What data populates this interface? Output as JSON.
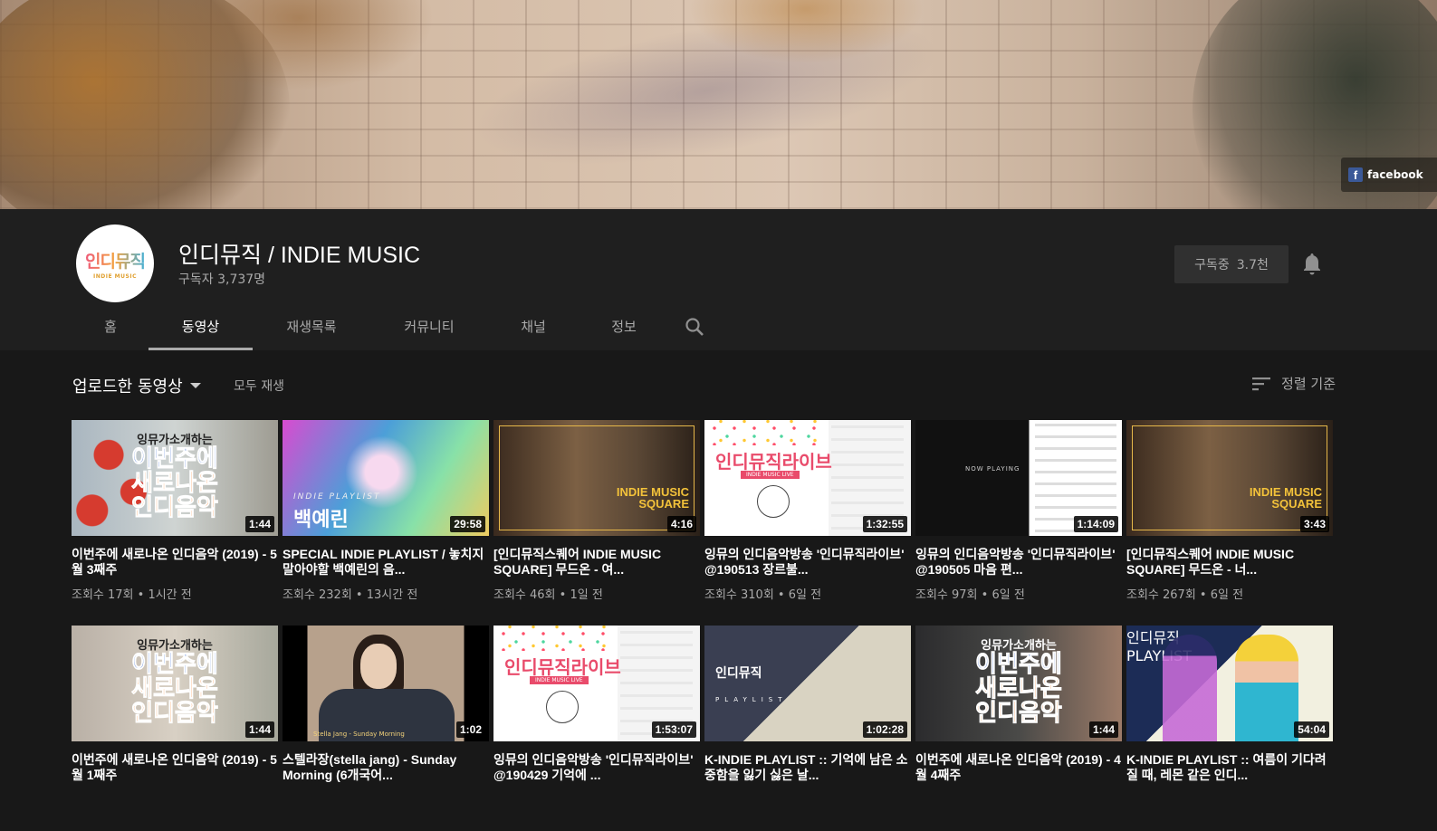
{
  "banner": {
    "facebook_label": "facebook"
  },
  "channel": {
    "avatar_text": "인디뮤직",
    "avatar_subtext": "INDIE MUSIC",
    "title": "인디뮤직 / INDIE MUSIC",
    "subscribers": "구독자 3,737명",
    "subscribe_label": "구독중",
    "subscribe_count": "3.7천"
  },
  "tabs": [
    {
      "label": "홈"
    },
    {
      "label": "동영상",
      "active": true
    },
    {
      "label": "재생목록"
    },
    {
      "label": "커뮤니티"
    },
    {
      "label": "채널"
    },
    {
      "label": "정보"
    }
  ],
  "section": {
    "uploads_label": "업로드한 동영상",
    "play_all": "모두 재생",
    "sort_label": "정렬 기준"
  },
  "thumb_text": {
    "curator": "잉뮤가소개하는",
    "line1": "이번주에",
    "line2": "새로나온",
    "line3": "인디음악",
    "indie_playlist": "INDIE PLAYLIST",
    "playlist_name": "백예린",
    "square_line1": "INDIE MUSIC",
    "square_line2": "SQUARE",
    "live_title": "인디뮤직라이브",
    "live_sub": "INDIE MUSIC LIVE",
    "now_playing": "NOW PLAYING",
    "girl_caption": "Stella Jang - Sunday Morning",
    "kp_title": "인디뮤직",
    "kp_sub": "PLAYLIST"
  },
  "videos": [
    {
      "title": "이번주에 새로나온 인디음악 (2019) - 5월 3째주",
      "views": "조회수 17회",
      "age": "1시간 전",
      "duration": "1:44"
    },
    {
      "title": "SPECIAL INDIE PLAYLIST / 놓치지 말아야할 백예린의 음...",
      "views": "조회수 232회",
      "age": "13시간 전",
      "duration": "29:58"
    },
    {
      "title": "[인디뮤직스퀘어 INDIE MUSIC SQUARE] 무드온 - 여...",
      "views": "조회수 46회",
      "age": "1일 전",
      "duration": "4:16"
    },
    {
      "title": "잉뮤의 인디음악방송 '인디뮤직라이브' @190513 장르불...",
      "views": "조회수 310회",
      "age": "6일 전",
      "duration": "1:32:55"
    },
    {
      "title": "잉뮤의 인디음악방송 '인디뮤직라이브' @190505 마음 편...",
      "views": "조회수 97회",
      "age": "6일 전",
      "duration": "1:14:09"
    },
    {
      "title": "[인디뮤직스퀘어 INDIE MUSIC SQUARE] 무드온 - 너...",
      "views": "조회수 267회",
      "age": "6일 전",
      "duration": "3:43"
    },
    {
      "title": "이번주에 새로나온 인디음악 (2019) - 5월 1째주",
      "views": "",
      "age": "",
      "duration": "1:44"
    },
    {
      "title": "스텔라장(stella jang) - Sunday Morning (6개국어...",
      "views": "",
      "age": "",
      "duration": "1:02"
    },
    {
      "title": "잉뮤의 인디음악방송 '인디뮤직라이브' @190429 기억에 ...",
      "views": "",
      "age": "",
      "duration": "1:53:07"
    },
    {
      "title": "K-INDIE PLAYLIST :: 기억에 남은 소중함을 잃기 싫은 날...",
      "views": "",
      "age": "",
      "duration": "1:02:28"
    },
    {
      "title": "이번주에 새로나온 인디음악 (2019) - 4월 4째주",
      "views": "",
      "age": "",
      "duration": "1:44"
    },
    {
      "title": "K-INDIE PLAYLIST :: 여름이 기다려질 때, 레몬 같은 인디...",
      "views": "",
      "age": "",
      "duration": "54:04"
    }
  ]
}
